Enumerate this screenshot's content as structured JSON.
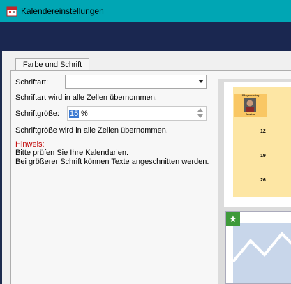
{
  "window": {
    "title": "Kalendereinstellungen"
  },
  "tabs": [
    {
      "label": "Farbe und Schrift"
    }
  ],
  "font": {
    "label": "Schriftart:",
    "value": "",
    "note": "Schriftart wird in alle Zellen übernommen."
  },
  "font_size": {
    "label": "Schriftgröße:",
    "value": "15",
    "unit": "%",
    "note": "Schriftgröße wird in alle Zellen übernommen."
  },
  "hint": {
    "label": "Hinweis:",
    "line1": "Bitte prüfen Sie Ihre Kalendarien.",
    "line2": "Bei größerer Schrift können Texte angeschnitten werden."
  },
  "preview": {
    "caption": "Pflegemontag",
    "name": "Marina",
    "days": [
      "12",
      "19",
      "26"
    ],
    "badge": "★"
  },
  "colors": {
    "titlebar": "#00a6b4",
    "header_band": "#1a2750",
    "hint": "#c00000",
    "selection": "#3a79d2",
    "calendar_bg": "#fde6a4",
    "badge": "#3e9a3a"
  }
}
